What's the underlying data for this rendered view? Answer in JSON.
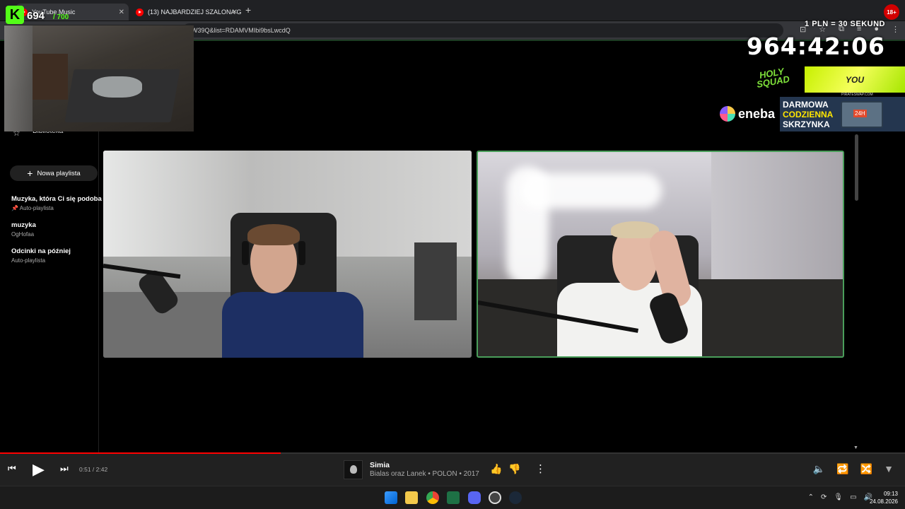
{
  "browser": {
    "tabs": [
      {
        "label": "YouTube Music",
        "active": true
      },
      {
        "label": "(13) NAJBARDZIEJ SZALONA G",
        "active": false
      }
    ],
    "url": "W39Q&list=RDAMVMIbi9bsLwcdQ"
  },
  "overlay": {
    "sub_count": "694",
    "sub_goal": "/ 700",
    "rate": "1 PLN = 30 SEKUND",
    "timer": "964:42:06",
    "age_badge": "18+",
    "holy_squad": "HOLY SQUAD",
    "yellow_banner": "YOU",
    "pirate": "PIRATESWAP.COM",
    "eneba": "eneba",
    "promo_line1": "DARMOWA",
    "promo_line2": "CODZIENNA",
    "promo_line3": "SKRZYNKA",
    "chest_label": "24H"
  },
  "sidebar": {
    "library_label": "Biblioteka",
    "new_playlist_label": "Nowa playlista",
    "playlists": [
      {
        "title": "Muzyka, która Ci się podoba",
        "sub": "Auto-playlista",
        "pinned": true
      },
      {
        "title": "muzyka",
        "sub": "OgHofaa",
        "pinned": false
      },
      {
        "title": "Odcinki na później",
        "sub": "Auto-playlista",
        "pinned": false
      }
    ]
  },
  "player": {
    "time": "0:51 / 2:42",
    "progress_fraction": 0.31,
    "song_title": "Simia",
    "song_sub": "Bialas oraz Lanek • POLON • 2017"
  },
  "taskbar": {
    "time": "09:13",
    "date": "24.08.2026"
  },
  "colors": {
    "accent_red": "#ff0000",
    "kick_green": "#53fc18",
    "cam_border": "#4a9e5a"
  }
}
